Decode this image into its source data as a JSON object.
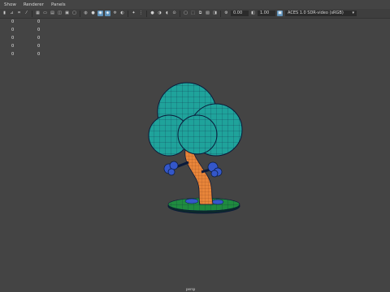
{
  "menubar": {
    "show": "Show",
    "renderer": "Renderer",
    "panels": "Panels"
  },
  "toolbar": {
    "gamma_value": "0.00",
    "exposure_value": "1.00",
    "color_space": "ACES 1.0 SDR-video (sRGB)",
    "icons": [
      "select-camera-icon",
      "lock-camera-icon",
      "bookmark-icon",
      "image-plane-icon",
      "grid-icon",
      "film-gate-icon",
      "resolution-gate-icon",
      "field-chart-icon",
      "safe-action-icon",
      "safe-title-icon",
      "wireframe-icon",
      "smooth-shade-icon",
      "wireframe-on-shaded-icon",
      "textured-icon",
      "lights-icon",
      "shadows-icon",
      "ambient-occlusion-icon",
      "antialiasing-icon",
      "depth-of-field-icon",
      "isolate-select-icon",
      "xray-icon",
      "xray-joints-icon",
      "backface-icon"
    ]
  },
  "hud": {
    "rows": [
      {
        "a": "0",
        "b": "0"
      },
      {
        "a": "0",
        "b": "0"
      },
      {
        "a": "0",
        "b": "0"
      },
      {
        "a": "0",
        "b": "0"
      },
      {
        "a": "0",
        "b": "0"
      }
    ]
  },
  "viewport": {
    "bottom_label": "persp",
    "colors": {
      "canopy": "#1fa39b",
      "wire": "#0a1a3a",
      "trunk": "#e8853a",
      "ground": "#1f8b3f",
      "flower": "#3457c9"
    }
  }
}
